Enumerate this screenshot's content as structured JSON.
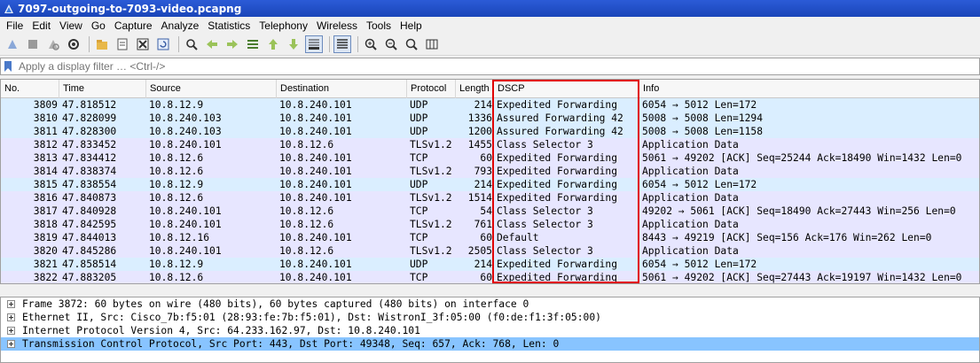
{
  "window": {
    "title": "7097-outgoing-to-7093-video.pcapng"
  },
  "menu": [
    "File",
    "Edit",
    "View",
    "Go",
    "Capture",
    "Analyze",
    "Statistics",
    "Telephony",
    "Wireless",
    "Tools",
    "Help"
  ],
  "filter": {
    "placeholder": "Apply a display filter … <Ctrl-/>",
    "value": ""
  },
  "columns": [
    "No.",
    "Time",
    "Source",
    "Destination",
    "Protocol",
    "Length",
    "DSCP",
    "Info"
  ],
  "packets": [
    {
      "no": "3809",
      "time": "47.818512",
      "src": "10.8.12.9",
      "dst": "10.8.240.101",
      "proto": "UDP",
      "len": "214",
      "dscp": "Expedited Forwarding",
      "info": "6054 → 5012 Len=172",
      "kind": "udp"
    },
    {
      "no": "3810",
      "time": "47.828099",
      "src": "10.8.240.103",
      "dst": "10.8.240.101",
      "proto": "UDP",
      "len": "1336",
      "dscp": "Assured Forwarding 42",
      "info": "5008 → 5008 Len=1294",
      "kind": "udp"
    },
    {
      "no": "3811",
      "time": "47.828300",
      "src": "10.8.240.103",
      "dst": "10.8.240.101",
      "proto": "UDP",
      "len": "1200",
      "dscp": "Assured Forwarding 42",
      "info": "5008 → 5008 Len=1158",
      "kind": "udp"
    },
    {
      "no": "3812",
      "time": "47.833452",
      "src": "10.8.240.101",
      "dst": "10.8.12.6",
      "proto": "TLSv1.2",
      "len": "1455",
      "dscp": "Class Selector 3",
      "info": "Application Data",
      "kind": "tcp"
    },
    {
      "no": "3813",
      "time": "47.834412",
      "src": "10.8.12.6",
      "dst": "10.8.240.101",
      "proto": "TCP",
      "len": "60",
      "dscp": "Expedited Forwarding",
      "info": "5061 → 49202 [ACK] Seq=25244 Ack=18490 Win=1432 Len=0",
      "kind": "tcp"
    },
    {
      "no": "3814",
      "time": "47.838374",
      "src": "10.8.12.6",
      "dst": "10.8.240.101",
      "proto": "TLSv1.2",
      "len": "793",
      "dscp": "Expedited Forwarding",
      "info": "Application Data",
      "kind": "tcp"
    },
    {
      "no": "3815",
      "time": "47.838554",
      "src": "10.8.12.9",
      "dst": "10.8.240.101",
      "proto": "UDP",
      "len": "214",
      "dscp": "Expedited Forwarding",
      "info": "6054 → 5012 Len=172",
      "kind": "udp"
    },
    {
      "no": "3816",
      "time": "47.840873",
      "src": "10.8.12.6",
      "dst": "10.8.240.101",
      "proto": "TLSv1.2",
      "len": "1514",
      "dscp": "Expedited Forwarding",
      "info": "Application Data",
      "kind": "tcp"
    },
    {
      "no": "3817",
      "time": "47.840928",
      "src": "10.8.240.101",
      "dst": "10.8.12.6",
      "proto": "TCP",
      "len": "54",
      "dscp": "Class Selector 3",
      "info": "49202 → 5061 [ACK] Seq=18490 Ack=27443 Win=256 Len=0",
      "kind": "tcp"
    },
    {
      "no": "3818",
      "time": "47.842595",
      "src": "10.8.240.101",
      "dst": "10.8.12.6",
      "proto": "TLSv1.2",
      "len": "761",
      "dscp": "Class Selector 3",
      "info": "Application Data",
      "kind": "tcp"
    },
    {
      "no": "3819",
      "time": "47.844013",
      "src": "10.8.12.16",
      "dst": "10.8.240.101",
      "proto": "TCP",
      "len": "60",
      "dscp": "Default",
      "info": "8443 → 49219 [ACK] Seq=156 Ack=176 Win=262 Len=0",
      "kind": "tcp"
    },
    {
      "no": "3820",
      "time": "47.845286",
      "src": "10.8.240.101",
      "dst": "10.8.12.6",
      "proto": "TLSv1.2",
      "len": "2505",
      "dscp": "Class Selector 3",
      "info": "Application Data",
      "kind": "tcp"
    },
    {
      "no": "3821",
      "time": "47.858514",
      "src": "10.8.12.9",
      "dst": "10.8.240.101",
      "proto": "UDP",
      "len": "214",
      "dscp": "Expedited Forwarding",
      "info": "6054 → 5012 Len=172",
      "kind": "udp"
    },
    {
      "no": "3822",
      "time": "47.883205",
      "src": "10.8.12.6",
      "dst": "10.8.240.101",
      "proto": "TCP",
      "len": "60",
      "dscp": "Expedited Forwarding",
      "info": "5061 → 49202 [ACK] Seq=27443 Ack=19197 Win=1432 Len=0",
      "kind": "tcp"
    }
  ],
  "details": [
    {
      "text": "Frame 3872: 60 bytes on wire (480 bits), 60 bytes captured (480 bits) on interface 0",
      "selected": false
    },
    {
      "text": "Ethernet II, Src: Cisco_7b:f5:01 (28:93:fe:7b:f5:01), Dst: WistronI_3f:05:00 (f0:de:f1:3f:05:00)",
      "selected": false
    },
    {
      "text": "Internet Protocol Version 4, Src: 64.233.162.97, Dst: 10.8.240.101",
      "selected": false
    },
    {
      "text": "Transmission Control Protocol, Src Port: 443, Dst Port: 49348, Seq: 657, Ack: 768, Len: 0",
      "selected": true
    }
  ],
  "colors": {
    "udp_row": "#daeeff",
    "tcp_row": "#e7e6ff",
    "highlight_box": "#e00000",
    "selected_detail": "#88c4ff"
  }
}
